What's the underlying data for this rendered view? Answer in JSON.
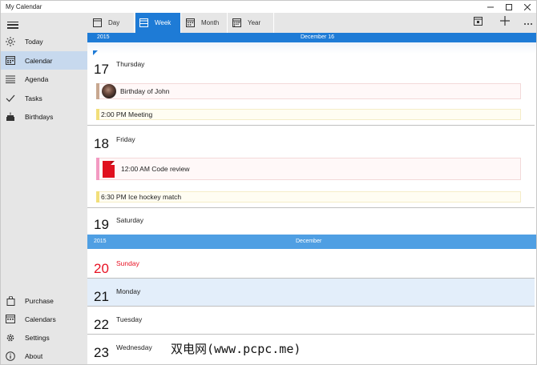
{
  "window": {
    "title": "My Calendar",
    "controls": [
      "minimize-icon",
      "maximize-icon",
      "close-icon"
    ]
  },
  "sidebar": {
    "items": [
      {
        "label": "Today",
        "icon": "sun-icon"
      },
      {
        "label": "Calendar",
        "icon": "calendar-icon",
        "active": true
      },
      {
        "label": "Agenda",
        "icon": "list-icon"
      },
      {
        "label": "Tasks",
        "icon": "checkmark-icon"
      },
      {
        "label": "Birthdays",
        "icon": "cake-icon"
      }
    ],
    "bottom_items": [
      {
        "label": "Purchase",
        "icon": "shopping-bag-icon"
      },
      {
        "label": "Calendars",
        "icon": "calendars-icon"
      },
      {
        "label": "Settings",
        "icon": "gear-icon"
      },
      {
        "label": "About",
        "icon": "info-icon"
      }
    ]
  },
  "tabs": [
    {
      "label": "Day",
      "icon": "day-view-icon"
    },
    {
      "label": "Week",
      "icon": "week-view-icon",
      "active": true
    },
    {
      "label": "Month",
      "icon": "month-view-icon"
    },
    {
      "label": "Year",
      "icon": "year-view-icon"
    }
  ],
  "toolbar": {
    "buttons": [
      "go-to-today-icon",
      "add-icon",
      "more-icon"
    ]
  },
  "header": {
    "year": "2015",
    "date": "December 16"
  },
  "days": [
    {
      "num": "17",
      "name": "Thursday",
      "events": [
        {
          "text": "Birthday of John",
          "type": "birthday"
        },
        {
          "text": "2:00 PM Meeting",
          "type": "meeting"
        }
      ]
    },
    {
      "num": "18",
      "name": "Friday",
      "events": [
        {
          "text": "12:00 AM Code review",
          "type": "task"
        },
        {
          "text": "6:30 PM Ice hockey match",
          "type": "meeting"
        }
      ]
    },
    {
      "num": "19",
      "name": "Saturday",
      "events": []
    },
    {
      "num": "20",
      "name": "Sunday",
      "events": []
    },
    {
      "num": "21",
      "name": "Monday",
      "events": []
    },
    {
      "num": "22",
      "name": "Tuesday",
      "events": []
    },
    {
      "num": "23",
      "name": "Wednesday",
      "events": []
    }
  ],
  "month_band": {
    "year": "2015",
    "month": "December"
  },
  "watermark": "双电网(www.pcpc.me)",
  "colors": {
    "accent": "#1e7bd6",
    "month_band": "#4f9fe3",
    "sunday_red": "#e81123",
    "today_row": "#e3eefa",
    "birthday_bar": "#c8a890",
    "meeting_bar": "#f2df7a",
    "task_bar": "#f39ac2"
  }
}
